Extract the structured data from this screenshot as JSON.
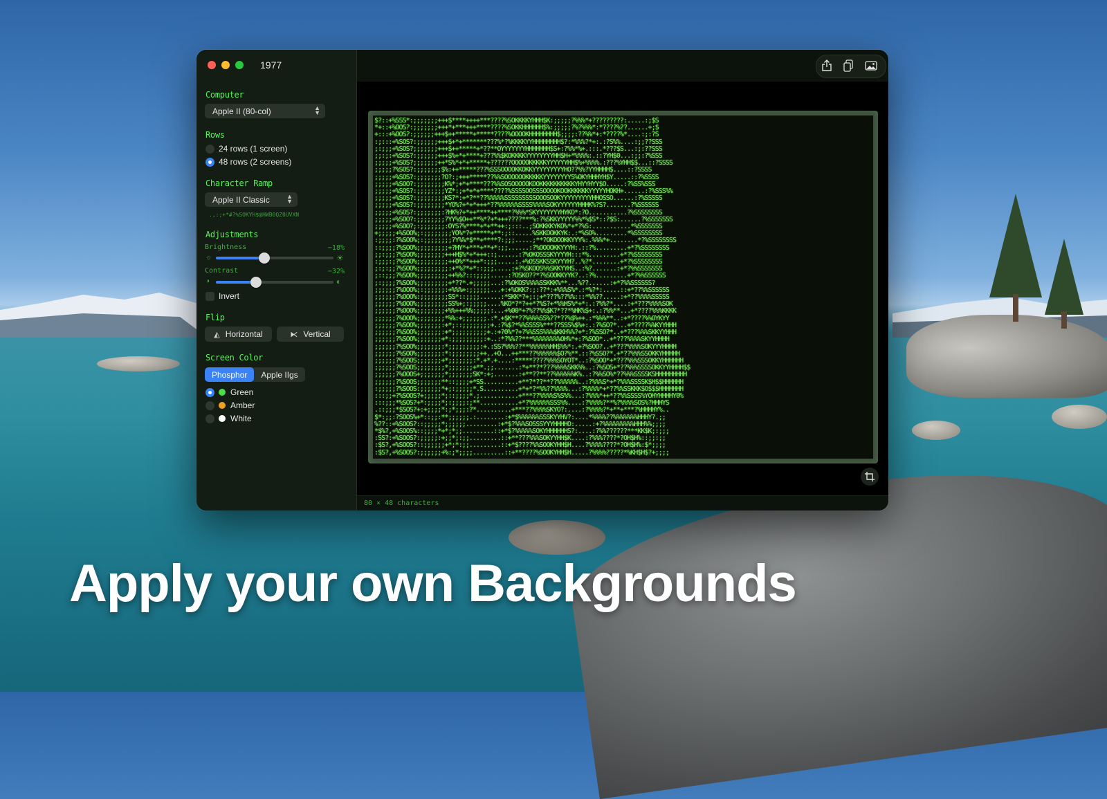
{
  "headline": "Apply your own Backgrounds",
  "window": {
    "title": "1977"
  },
  "sidebar": {
    "computer": {
      "heading": "Computer",
      "selected": "Apple II (80-col)"
    },
    "rows": {
      "heading": "Rows",
      "options": [
        {
          "label": "24 rows (1 screen)",
          "selected": false
        },
        {
          "label": "48 rows (2 screens)",
          "selected": true
        }
      ]
    },
    "character_ramp": {
      "heading": "Character Ramp",
      "selected": "Apple II Classic",
      "preview": " .,:;+*#?%SOKYH$@HWB0QZ0UVXN"
    },
    "adjustments": {
      "heading": "Adjustments",
      "brightness": {
        "label": "Brightness",
        "value_text": "−18%",
        "level": 0.41
      },
      "contrast": {
        "label": "Contrast",
        "value_text": "−32%",
        "level": 0.34
      },
      "invert": {
        "label": "Invert",
        "checked": false
      }
    },
    "flip": {
      "heading": "Flip",
      "horizontal": "Horizontal",
      "vertical": "Vertical"
    },
    "screen_color": {
      "heading": "Screen Color",
      "tabs": [
        {
          "label": "Phosphor",
          "active": true
        },
        {
          "label": "Apple IIgs",
          "active": false
        }
      ],
      "options": [
        {
          "label": "Green",
          "color": "#4ade4a",
          "selected": true
        },
        {
          "label": "Amber",
          "color": "#f0a020",
          "selected": false
        },
        {
          "label": "White",
          "color": "#ffffff",
          "selected": false
        }
      ]
    }
  },
  "toolbar": {
    "icons": [
      "share-icon",
      "copy-icon",
      "image-icon"
    ]
  },
  "screen": {
    "phosphor_color": "#7af25c",
    "lines": [
      "$?::+%SSS*:;;;;;;;+++$****++++***????%SOKKKKYHHH$K:;;;;;?%%%*+?????????:.....:;$S",
      "*+::+%OOS?:;;;;;;;+++*+***+++****????%SOKKHHHHHH$%:;;;;;?%?%%%*:*????%??......+;$",
      "+:::+%OOS?:;;;;;;+++$++*****+*****????%OOOOKHHHHHHHH$;;;;:??%%*+:*????%*....:;:?S",
      ":;:::+%SOS?:;;;;;;+++$+*+*******???%*?%KKKKYYHHHHHHHH$?:*%%%?*+:.:?S%%....:;;??SSS",
      ";:;;;+%SOS?;;;;;;;+++$++*****+*??**OYYYYYYYHHHHHHH$S+:?%%*%+.:::.*???$S...:;:??SSS",
      ";;:;:+%SOS?:;;;;;;+++$%+*+****+???%%$KOKKKKYYYYYYYYHH$H+*%%%%:.::?YH$0...:;;:?%SSS",
      ";;;;;+%SOS?;;;;;;;++*S%*+*+*****+??????OOOOOKKKKKYYYYYYHH$%+%%%%.:???%YHH$$...::?SSSS",
      ";;;;;?%SOS?:;;;;;;;$%:++*****???%SSSOOOOKKOKKYYYYYYYYYHO??%%?YYHHHH$....::?SSSS",
      ";;;;;+%SOS?:;;;;;;;?O?:;+++*****??%%SOOOOOOKKKKKYYYYYYYYS%OKYHHHYH$Y.....::?%SSSS",
      ";;;;;+%SOO?:;;;;;;;;K%*;+*+****???%%SOSOOOOOKOOKKKKKKKKKKYHYYHYY$O.....:?%SS%SSS",
      ";;;;;+%SOS?:;;;;;;;;YZ*:;+*+*+****????%SSSSOOSSSOOOOKOOKKKKKKYYYYYHOKH+......:?%SSS%%",
      ";;;;;+%SOS?:;;;;;;;;KS?*:+*?**??%%%%%SSSSSSSSSOOOSOOKYYYYYYYYYHHOSSO......:?%SSSSS",
      ";;;;;+%SOS?:;;;;;;;;*YO%?+*+*+++*??%%%%%%SSSS%%%%SOKYYYYYYHHHK%?S?.......?%SSSSSS",
      ";;;;;+%SOS?:;;;;;;;:?HK%?+*++****++****?%%%*SKYYYYYYYHYKO*:?O...........?%SSSSSSSS",
      ";;;;;+%SOO?:;;;;;;;;?YY%$O++**%*?+*+++????***%:?%SKKYYYYY%%*%$S*::?$S:......?%SSSSSSS",
      ";;;;;+%SOO?;:;;;;;;;:OYS?%****+*+**++:;:::..;SOKKKKYKO%*+*?%S:...........*%SSSSSSS",
      "+;;;;;+%SOO%;:;;;;;;;;YO%*?+*****+**:;::.....%SKKOOKKYK:.:*%SO%.........*%SSSSSSSS",
      ":;;;;:?%SOO%;:;;;;;;;;?Y%%*$**+****?:;;;.....;**?OKOOOKKYYY%:.%%%*+........*?%SSSSSSSS",
      "::;;;;?%SOO%;;;;;;;;;+?HY*+***+**+*:;;......:?%OOOOKKYYYH:.::?%.........+*?%SSSSSSSS",
      ";;:;;;?%SOO%;;;;;;;;+++H$%*+*+++::;......:?%OKOSSSKYYYYH:::*%.........+*?%SSSSSSSS",
      ":;;;:;?%SOO%;;;;;;;;;++0%**+++*:;;;.....:.+%OSSKKSSKYYYH?..%?*........+*?%SSSSSSSS",
      ";:;:;;?%SOO%;;;;;;;;;:+*%?*+*::;;;.....:+?%SKOOS%%SKKYYHS..:%?.......:+*?%%SSSSSSS",
      ";::;;;?%SOO%;;;;;;;;;++%%?:::;;;;.....:?OSKO??*?%SOOKKYYK?..:?%.........+*?%%SSSSSS",
      ";:;;;;?%SOO%;;;;;;;;;+*??*.+;;;;;...:?%OKOS%%%%SSKKK%**...%??......:+*?%%SSSSSS?",
      ";;;;;;?%OOO%;:;;;;;;:+%%%+:;;;;;;...+:+%OKK?:;:??*:+%%%S%*.:*%?*:.....::+*??%%SSSSSS",
      ";;;;;;?%OOO%:;;;;;;;;SS*::;;;;......:*SKK*?+;:;+*???%??%%:::*%%??.....:+*??%%%%SSSSS",
      ";;;;;;?%OOO%;;;;;;;;;SS%+;:;;;;;....%KO*?*?++*?%S?+*%%HS%*+*:.:?%%?*....:+*???%%%%SOK",
      ";;;;;;?%OOO%;;;;;;;;+%%+++%%;;;;;:...+%00*+?%??%%$K?*??*%HK%$+:.:?%%**...+*????%%%KKKK",
      ";;;;;;?%OOO%;;;;;;;;*%%:+;;;;;;;.:*.+$K**??%%%%SS%??*??%$%++.:*%%%**..:+*????%%OYKYY",
      ";;;;;;?%SOO%;;;;;;;:+*;::;;;;;;;;+.:?%$?*%%SSSS%***??SSS%$%+:.:?%SO?*...+*????%%KYYHHH",
      ";;;;;;?%SOO%;;;;;;;:+*;;;;;;;;;;+.:+?0%*?+?%%SSS%%%$KKH%%?+*:?%SSO?*..+*???%%%SKKYYHHH",
      ";;;;;;?%SOO%;;;;;;;+*:;;;;;;;;;:+..:*?%%??***%%%%%%%%OH%*+:?%SOO*..+*???%%%%SKYYHHHH",
      ";;;;;;?%SOO%;;;;;;;:*;;;;;;;;;:+.:SS?%%%??**%%%%%%HH$%%*:.+?%SOO?..+*???%%%%SOKYYYHHHH",
      ";;;;;;?%SOO%;;;;;;;:*:;;;;;;;;++..+O...++***??%%%%%%$O?%**.::?%SSO?*.+*??%%%SSOKKYHHHHH",
      ";;;;;;?%SOOS;;;;;;;+*;;;;;;;:*.+*.+....:*****????%%%SOYOT*..:?%SOO*+*???%%%SSSOKKYHHHHHH",
      ";;;;;;?%SOOS;;;;;;;;*;;;;;;;+**.;;.......:*+**?*???%%%%SKK%%..:?%SOS+*??%%%SSSSOKKYYHHHH$$",
      ";;;;;;?%OOOS+;;;;;;;*;;;;;;;SK*:+;.......:+**??**??%%%%%%K%..:?%%SO%*??%%%SSSSKSHHHHHHHHH",
      ";;;;;;?%SOOS;;;;;;;**::;;;;+*SS..........+**?*??**??%%%%%%..:?%%%S*+*?%%%SSSSK$H$$HHHHHH",
      ":;;;;;?%SOOS:;;;;;;*+;:;;;;;*.S..........+*+*?*%%??%%%%...:?%%%%*+*??%%SSKKK$O$$$HHHHHHH",
      ":::;;+?%SOOS?+;;;;;*;::;;;;*.;...........+***??%%%%S%S%%...:?%%%*++*??%%SSSS%YOHYHHHHY0%",
      ":::;;;*%SOS?+*:;;;;*;:;;;;:;**...........+*?%%%%%%SSS%%....:?%%%%?**%?%%%%SOS%?HHHYS",
      ".::;;;*$SOS?+:+;;;;*:;*;;;:?*..........+***??%%%%SKYO?:....:?%%%%?*+**+***?%HHHHY%..",
      "$*:;;:?SOOS%+*::;;:**;;;;;;.:........:+*$%%%%%%SSSKYYHV?:....*%%%%??%%%%%%%HHHY?.;;",
      "%??::+%SOOS?::;;;;;*;;;;;;.........:+*$?%%%SOSSSYYYHHHHO:.....:+?%%%%%%%%%HHH%%;;;;",
      "*$%?,+%SOOS%::;;;;*+*;*;;.........::+*$?%%%%%SOKYHHHHHHS?:....:?%%??????***KK$K;:;;;",
      ":SS?:+%SOOS?:;;;;;:+;;*;:;;.........::+**???%%%SOKYYHH$K....:?%%%????*?OH$H%::;;:;;",
      ":$S?,+%SOOS?::;;;;;;+*;*:;;.........::+*$????%%SOOKYHH$H....?%%%%????*?OH$H%:$*;;;;",
      ":$S?,+%SOOS?:;;;;;;+%:;*;;;;.........::+**????%SOOKYHH$H.....?%%%%?????*%KH$H$?+;;;;"
    ]
  },
  "status": {
    "text": "80 × 48 characters"
  }
}
